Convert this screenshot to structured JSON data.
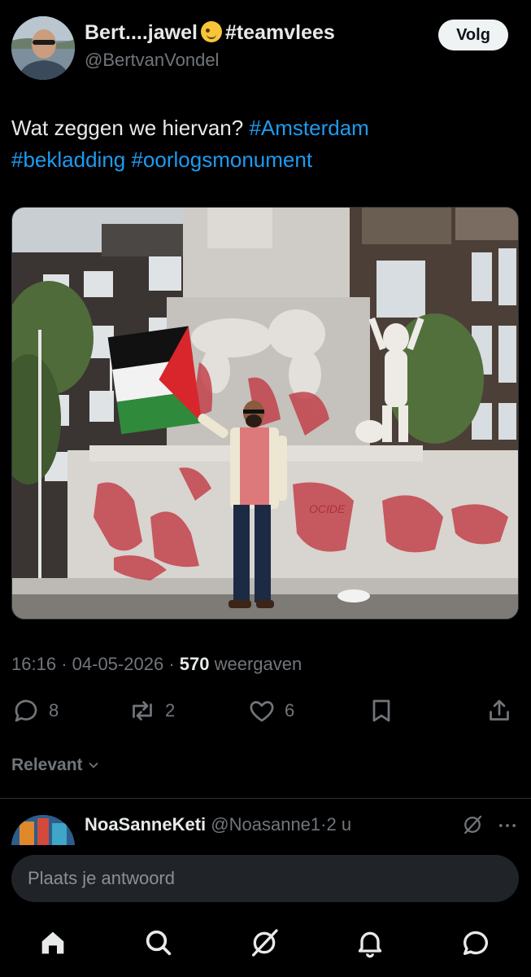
{
  "author": {
    "display_name": "Bert....jawel",
    "display_hashtag": "#teamvlees",
    "emoji": "winking-face-emoji",
    "handle": "@BertvanVondel"
  },
  "follow_button": {
    "label": "Volg"
  },
  "tweet": {
    "text_plain": "Wat zeggen we hiervan?",
    "tags": [
      "#Amsterdam",
      "#bekladding",
      "#oorlogsmonument"
    ]
  },
  "photo": {
    "alt": "Man met Palestijnse vlag voor beklad Nationaal Monument op de Dam",
    "graffiti_text": "OCIDE"
  },
  "meta": {
    "time": "16:16",
    "date": "04-05-2026",
    "views_count": "570",
    "views_label": "weergaven",
    "separator": "·"
  },
  "actions": {
    "replies": "8",
    "reposts": "2",
    "likes": "6"
  },
  "sort": {
    "label": "Relevant"
  },
  "reply_preview": {
    "display_name": "NoaSanneKeti",
    "handle": "@Noasanne1",
    "time": "2 u"
  },
  "compose": {
    "placeholder": "Plaats je antwoord"
  },
  "colors": {
    "background": "#000000",
    "text": "#e7e9ea",
    "muted": "#71767b",
    "link": "#1d9bf0",
    "follow_bg": "#eff3f4",
    "input_bg": "#202327"
  },
  "tabbar": [
    "home-icon",
    "search-icon",
    "grok-icon",
    "notifications-icon",
    "messages-icon"
  ]
}
